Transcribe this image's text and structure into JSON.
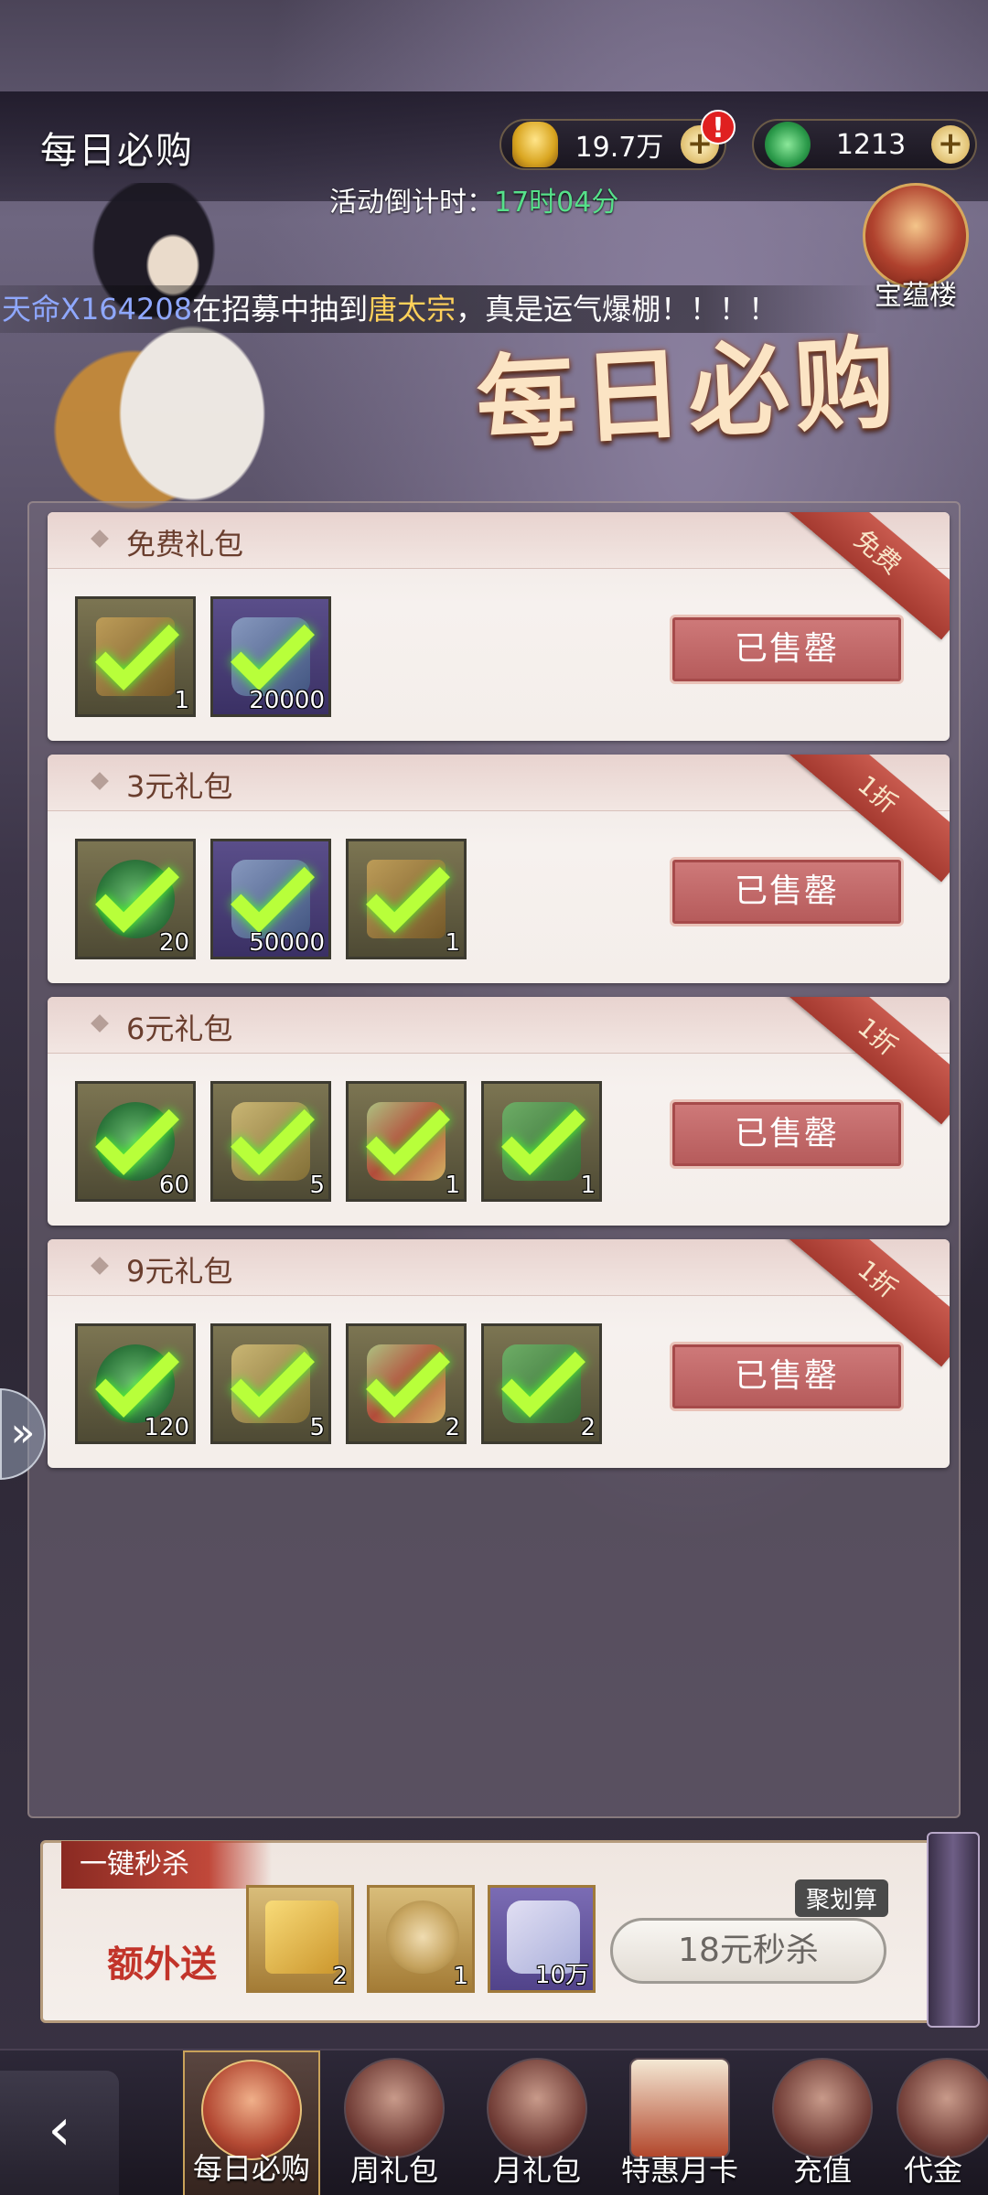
{
  "header": {
    "title": "每日必购",
    "gold_amount": "19.7万",
    "jade_amount": "1213",
    "alert_badge": "!",
    "plus_label": "+",
    "countdown_label": "活动倒计时：",
    "countdown_time": "17时04分",
    "treasure_label": "宝蕴楼",
    "banner_title": "每日必购"
  },
  "marquee": {
    "prefix": "天命",
    "player": "X164208",
    "middle": "在招募中抽到",
    "hero": "唐太宗",
    "suffix": "，真是运气爆棚！！！！"
  },
  "packs": [
    {
      "title": "免费礼包",
      "ribbon": "免费",
      "button": "已售罄",
      "items": [
        {
          "icon": "scroll-icon",
          "qty": "1",
          "purple": false
        },
        {
          "icon": "blue-scroll-icon",
          "qty": "20000",
          "purple": true
        }
      ]
    },
    {
      "title": "3元礼包",
      "ribbon": "1折",
      "button": "已售罄",
      "items": [
        {
          "icon": "jade-dragon-icon",
          "qty": "20",
          "purple": false
        },
        {
          "icon": "blue-scroll-icon",
          "qty": "50000",
          "purple": true
        },
        {
          "icon": "scroll-icon",
          "qty": "1",
          "purple": false
        }
      ]
    },
    {
      "title": "6元礼包",
      "ribbon": "1折",
      "button": "已售罄",
      "items": [
        {
          "icon": "jade-dragon-icon",
          "qty": "60",
          "purple": false
        },
        {
          "icon": "puzzle-icon",
          "qty": "5",
          "purple": false
        },
        {
          "icon": "mahjong-tiles-icon",
          "qty": "1",
          "purple": false
        },
        {
          "icon": "green-book-icon",
          "qty": "1",
          "purple": false
        }
      ]
    },
    {
      "title": "9元礼包",
      "ribbon": "1折",
      "button": "已售罄",
      "items": [
        {
          "icon": "jade-dragon-icon",
          "qty": "120",
          "purple": false
        },
        {
          "icon": "puzzle-icon",
          "qty": "5",
          "purple": false
        },
        {
          "icon": "mahjong-tiles-icon",
          "qty": "2",
          "purple": false
        },
        {
          "icon": "green-book-icon",
          "qty": "2",
          "purple": false
        }
      ]
    }
  ],
  "kill_bar": {
    "ribbon": "一键秒杀",
    "extra_label": "额外送",
    "tag": "聚划算",
    "price": "18元秒杀",
    "items": [
      {
        "icon": "question-token-icon",
        "qty": "2"
      },
      {
        "icon": "clover-coin-icon",
        "qty": "1"
      },
      {
        "icon": "paper-scroll-icon",
        "qty": "10万"
      }
    ]
  },
  "nav": {
    "back": "‹",
    "tabs": [
      "每日必购",
      "周礼包",
      "月礼包",
      "特惠月卡",
      "充值",
      "代金"
    ]
  },
  "colors": {
    "sold_button": "#b55a5a",
    "ribbon": "#a53a30",
    "countdown": "#56e08a",
    "check": "#b8ff3a"
  }
}
